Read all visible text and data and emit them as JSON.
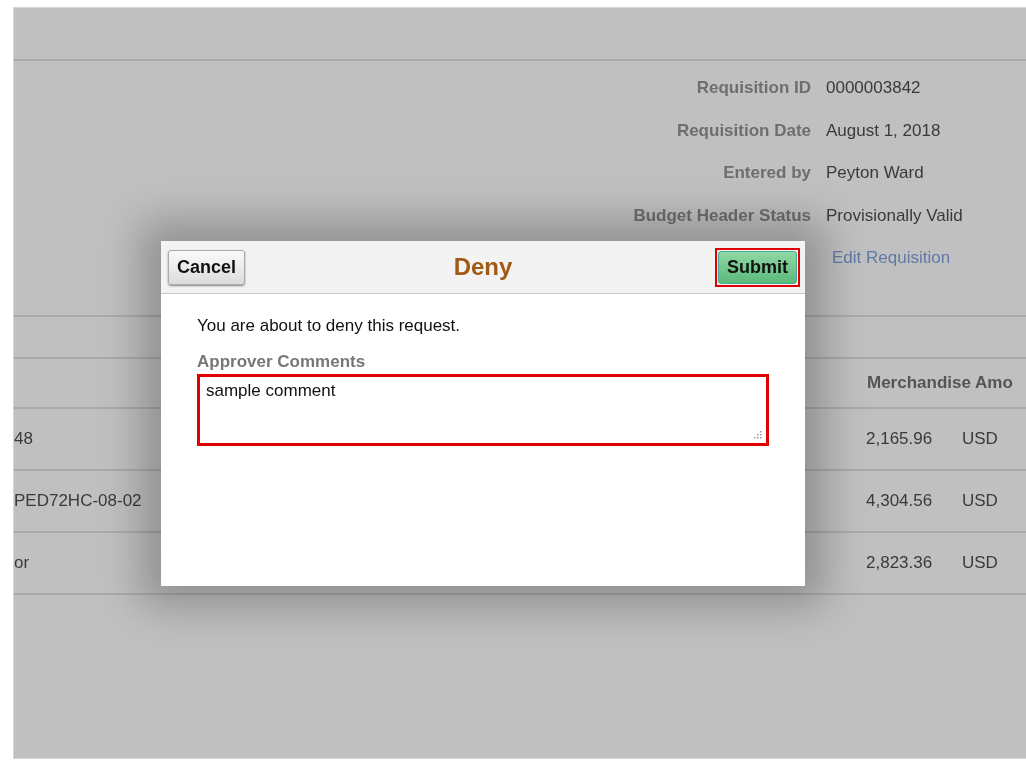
{
  "header_fields": [
    {
      "label": "Requisition ID",
      "value": "0000003842"
    },
    {
      "label": "Requisition Date",
      "value": "August 1, 2018"
    },
    {
      "label": "Entered by",
      "value": "Peyton Ward"
    },
    {
      "label": "Budget Header Status",
      "value": "Provisionally Valid"
    }
  ],
  "edit_link": "Edit Requisition",
  "table": {
    "columns": [
      "Merchandise Amo"
    ],
    "rows": [
      {
        "column_1": "48",
        "amount": "2,165.96",
        "currency": "USD"
      },
      {
        "column_1": "PED72HC-08-02",
        "amount": "4,304.56",
        "currency": "USD"
      },
      {
        "column_1": "or",
        "amount": "2,823.36",
        "currency": "USD"
      }
    ]
  },
  "dialog": {
    "title": "Deny",
    "cancel": {
      "label": "Cancel"
    },
    "submit": {
      "label": "Submit",
      "highlighted": true
    },
    "message": "You are about to deny this request.",
    "comments": {
      "label": "Approver Comments",
      "value": "sample comment",
      "highlighted": true
    }
  }
}
